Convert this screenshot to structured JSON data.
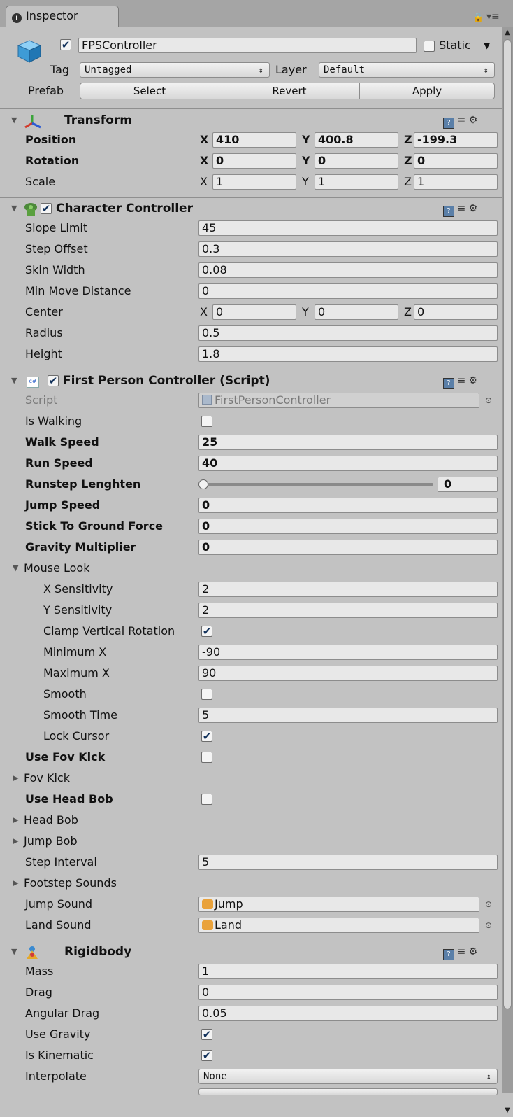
{
  "window": {
    "tab_label": "Inspector",
    "lock_icon": "lock-icon",
    "menu_icon": "menu-icon"
  },
  "object": {
    "name": "FPSController",
    "active": true,
    "static_label": "Static",
    "static": false,
    "tag_label": "Tag",
    "tag_value": "Untagged",
    "layer_label": "Layer",
    "layer_value": "Default",
    "prefab_label": "Prefab",
    "prefab_select": "Select",
    "prefab_revert": "Revert",
    "prefab_apply": "Apply"
  },
  "transform": {
    "title": "Transform",
    "position_label": "Position",
    "rotation_label": "Rotation",
    "scale_label": "Scale",
    "position": {
      "x": "410",
      "y": "400.8",
      "z": "-199.3"
    },
    "rotation": {
      "x": "0",
      "y": "0",
      "z": "0"
    },
    "scale": {
      "x": "1",
      "y": "1",
      "z": "1"
    },
    "axis_x": "X",
    "axis_y": "Y",
    "axis_z": "Z"
  },
  "character_controller": {
    "title": "Character Controller",
    "enabled": true,
    "slope_limit_label": "Slope Limit",
    "slope_limit": "45",
    "step_offset_label": "Step Offset",
    "step_offset": "0.3",
    "skin_width_label": "Skin Width",
    "skin_width": "0.08",
    "min_move_label": "Min Move Distance",
    "min_move": "0",
    "center_label": "Center",
    "center": {
      "x": "0",
      "y": "0",
      "z": "0"
    },
    "radius_label": "Radius",
    "radius": "0.5",
    "height_label": "Height",
    "height": "1.8"
  },
  "fps_script": {
    "title": "First Person Controller (Script)",
    "enabled": true,
    "script_label": "Script",
    "script_value": "FirstPersonController",
    "is_walking_label": "Is Walking",
    "is_walking": false,
    "walk_speed_label": "Walk Speed",
    "walk_speed": "25",
    "run_speed_label": "Run Speed",
    "run_speed": "40",
    "runstep_label": "Runstep Lenghten",
    "runstep": "0",
    "runstep_fraction": 0,
    "jump_speed_label": "Jump Speed",
    "jump_speed": "0",
    "stick_label": "Stick To Ground Force",
    "stick": "0",
    "gravity_mult_label": "Gravity Multiplier",
    "gravity_mult": "0",
    "mouse_look_label": "Mouse Look",
    "x_sens_label": "X Sensitivity",
    "x_sens": "2",
    "y_sens_label": "Y Sensitivity",
    "y_sens": "2",
    "clamp_label": "Clamp Vertical Rotation",
    "clamp": true,
    "min_x_label": "Minimum X",
    "min_x": "-90",
    "max_x_label": "Maximum X",
    "max_x": "90",
    "smooth_label": "Smooth",
    "smooth": false,
    "smooth_time_label": "Smooth Time",
    "smooth_time": "5",
    "lock_cursor_label": "Lock Cursor",
    "lock_cursor": true,
    "use_fov_label": "Use Fov Kick",
    "use_fov": false,
    "fov_kick_label": "Fov Kick",
    "use_head_bob_label": "Use Head Bob",
    "use_head_bob": false,
    "head_bob_label": "Head Bob",
    "jump_bob_label": "Jump Bob",
    "step_interval_label": "Step Interval",
    "step_interval": "5",
    "footstep_label": "Footstep Sounds",
    "jump_sound_label": "Jump Sound",
    "jump_sound": "Jump",
    "land_sound_label": "Land Sound",
    "land_sound": "Land"
  },
  "rigidbody": {
    "title": "Rigidbody",
    "mass_label": "Mass",
    "mass": "1",
    "drag_label": "Drag",
    "drag": "0",
    "ang_drag_label": "Angular Drag",
    "ang_drag": "0.05",
    "use_gravity_label": "Use Gravity",
    "use_gravity": true,
    "kinematic_label": "Is Kinematic",
    "kinematic": true,
    "interpolate_label": "Interpolate",
    "interpolate": "None"
  }
}
